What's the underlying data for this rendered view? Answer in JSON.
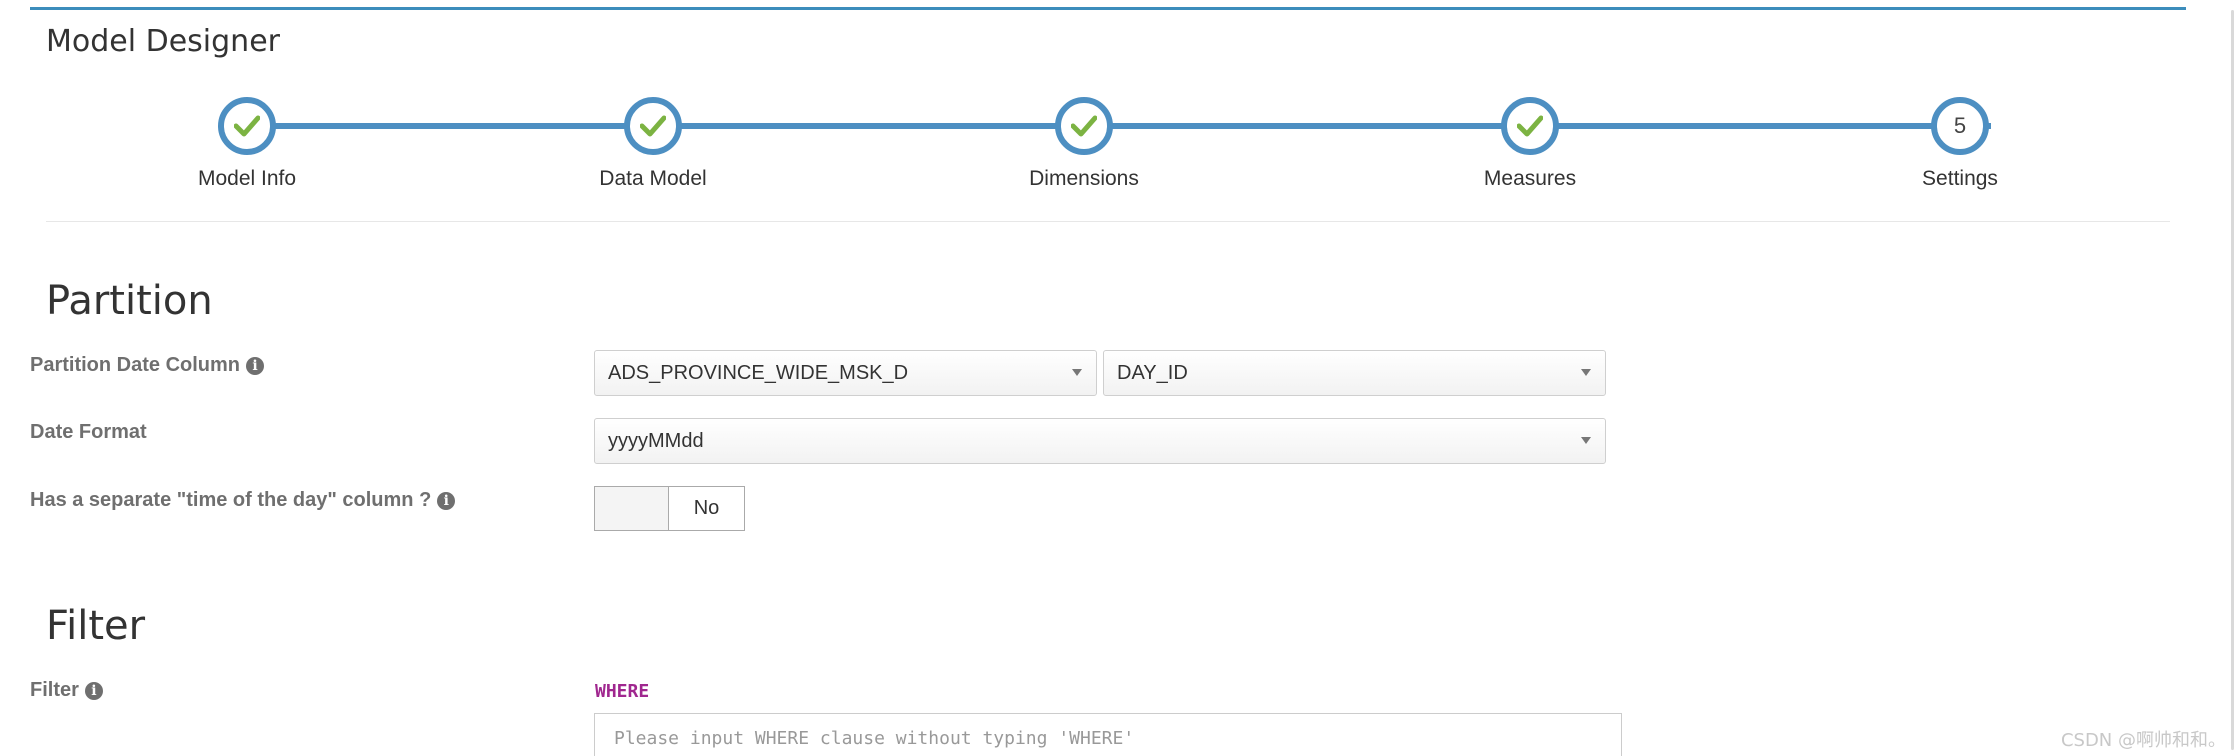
{
  "panel": {
    "title": "Model Designer"
  },
  "wizard": {
    "steps": [
      {
        "label": "Model Info",
        "state": "complete"
      },
      {
        "label": "Data Model",
        "state": "complete"
      },
      {
        "label": "Dimensions",
        "state": "complete"
      },
      {
        "label": "Measures",
        "state": "complete"
      },
      {
        "label": "Settings",
        "state": "current",
        "number": "5"
      }
    ]
  },
  "partition": {
    "title": "Partition",
    "date_column": {
      "label": "Partition Date Column",
      "table_value": "ADS_PROVINCE_WIDE_MSK_D",
      "column_value": "DAY_ID"
    },
    "date_format": {
      "label": "Date Format",
      "value": "yyyyMMdd"
    },
    "time_of_day": {
      "label": "Has a separate \"time of the day\" column ?",
      "toggle_value": "No"
    }
  },
  "filter": {
    "title": "Filter",
    "label": "Filter",
    "keyword": "WHERE",
    "placeholder": "Please input WHERE clause without typing 'WHERE'"
  },
  "watermark": "CSDN @啊帅和和。",
  "colors": {
    "accent": "#3c8dbc",
    "wizard": "#4d8fc2",
    "check": "#7cb342",
    "keyword": "#a0278f"
  }
}
